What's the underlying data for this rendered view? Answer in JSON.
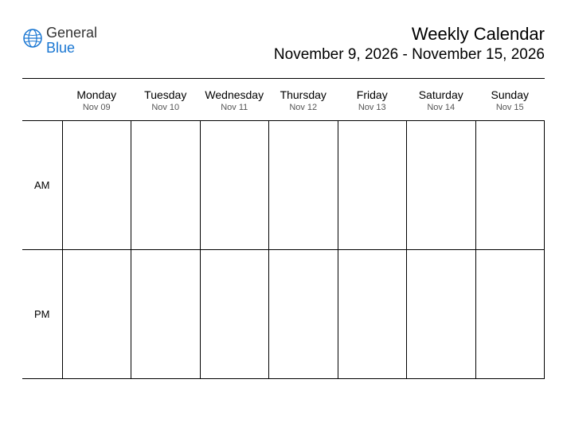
{
  "logo": {
    "general": "General",
    "blue": "Blue"
  },
  "header": {
    "title": "Weekly Calendar",
    "daterange": "November 9, 2026 - November 15, 2026"
  },
  "periods": {
    "am": "AM",
    "pm": "PM"
  },
  "days": [
    {
      "name": "Monday",
      "date": "Nov 09"
    },
    {
      "name": "Tuesday",
      "date": "Nov 10"
    },
    {
      "name": "Wednesday",
      "date": "Nov 11"
    },
    {
      "name": "Thursday",
      "date": "Nov 12"
    },
    {
      "name": "Friday",
      "date": "Nov 13"
    },
    {
      "name": "Saturday",
      "date": "Nov 14"
    },
    {
      "name": "Sunday",
      "date": "Nov 15"
    }
  ]
}
